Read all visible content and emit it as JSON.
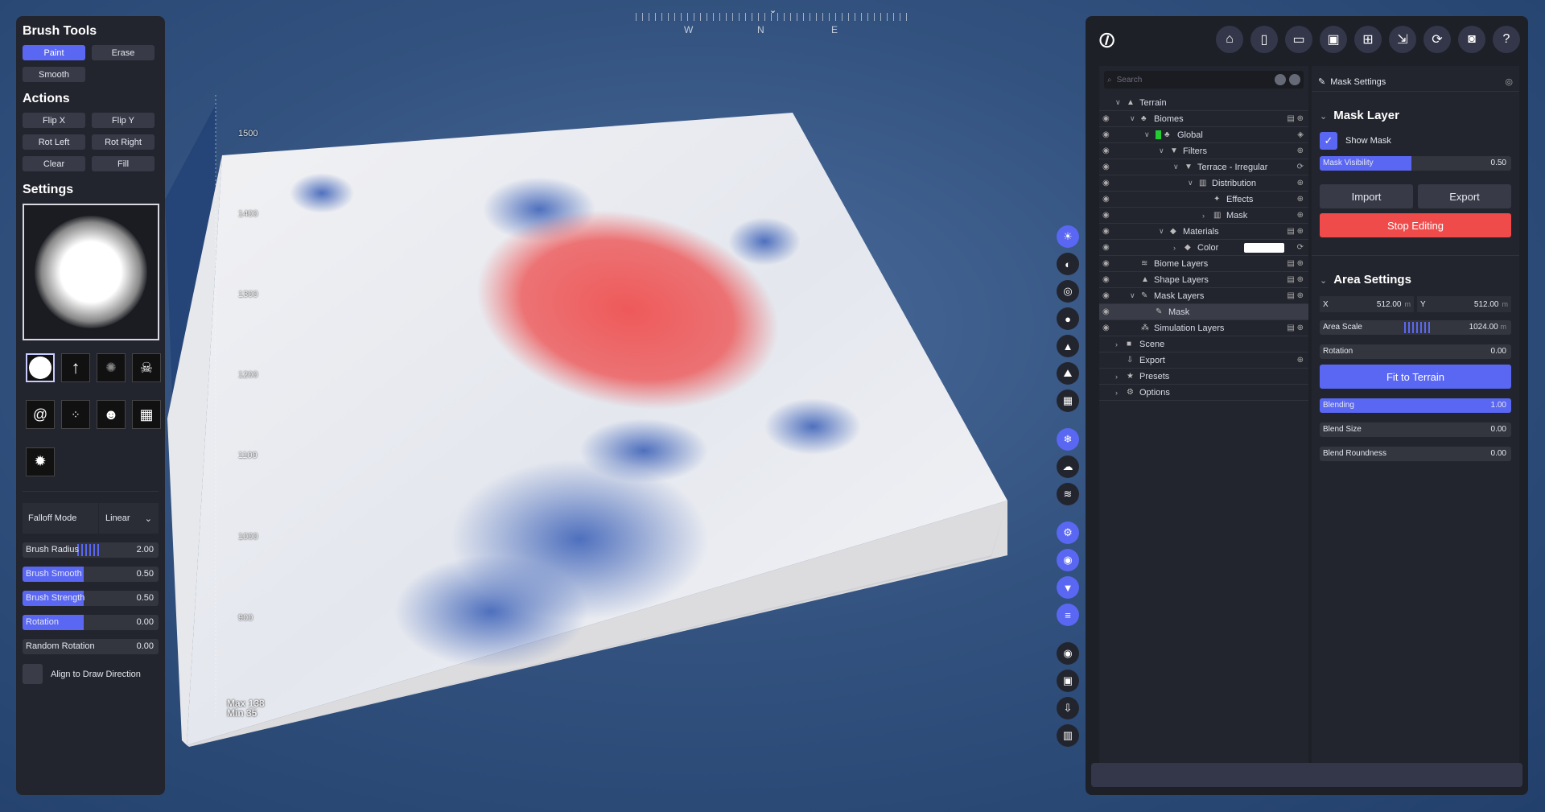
{
  "compass": {
    "labels": [
      "W",
      "N",
      "E"
    ]
  },
  "scale_labels": [
    "1500",
    "1400",
    "1300",
    "1200",
    "1100",
    "1000",
    "900"
  ],
  "stats": {
    "max": "Max 138",
    "min": "Min 35"
  },
  "brush_tools": {
    "title": "Brush Tools",
    "buttons": [
      "Paint",
      "Erase",
      "Smooth"
    ],
    "active": "Paint"
  },
  "actions": {
    "title": "Actions",
    "buttons": [
      "Flip X",
      "Flip Y",
      "Rot Left",
      "Rot Right",
      "Clear",
      "Fill"
    ]
  },
  "settings": {
    "title": "Settings",
    "brush_icons": [
      "circle-brush-icon",
      "arrow-brush-icon",
      "scatter-brush-icon",
      "skull-crossbones-brush-icon",
      "spiral-brush-icon",
      "dots-brush-icon",
      "skull-brush-icon",
      "checker-brush-icon",
      "splat-brush-icon"
    ],
    "falloff_label": "Falloff Mode",
    "falloff_value": "Linear",
    "sliders": [
      {
        "label": "Brush Radius",
        "value": "2.00",
        "fill": 0
      },
      {
        "label": "Brush Smooth",
        "value": "0.50",
        "fill": 0.45
      },
      {
        "label": "Brush Strength",
        "value": "0.50",
        "fill": 0.45
      },
      {
        "label": "Rotation",
        "value": "0.00",
        "fill": 0.45
      },
      {
        "label": "Random Rotation",
        "value": "0.00",
        "fill": 0
      }
    ],
    "align_label": "Align to Draw Direction"
  },
  "toolbar_icons": [
    "sun-icon",
    "globe-icon",
    "target-icon",
    "water-drop-icon",
    "mountain-icon",
    "person-landscape-icon",
    "grid-icon",
    "snowflake-icon",
    "cloud-icon",
    "waves-icon",
    "settings-icon",
    "eye-icon",
    "filter-icon",
    "layers-icon",
    "disc-icon",
    "image-icon",
    "download-icon",
    "chart-icon"
  ],
  "top_icons": [
    "home-icon",
    "new-file-icon",
    "open-folder-icon",
    "save-icon",
    "save-as-icon",
    "export-icon",
    "refresh-icon",
    "camera-icon",
    "help-icon"
  ],
  "search": {
    "placeholder": "Search"
  },
  "tree": [
    {
      "label": "Terrain",
      "depth": 0,
      "eye": false,
      "chev": "v",
      "icon": "▲",
      "action": ""
    },
    {
      "label": "Biomes",
      "depth": 1,
      "eye": true,
      "chev": "v",
      "icon": "♣",
      "action": "▤ ⊕"
    },
    {
      "label": "Global",
      "depth": 2,
      "eye": true,
      "chev": "v",
      "icon": "♣",
      "action": "◈",
      "swatch": "#22cc33"
    },
    {
      "label": "Filters",
      "depth": 3,
      "eye": true,
      "chev": "v",
      "icon": "▼",
      "action": "⊕"
    },
    {
      "label": "Terrace - Irregular",
      "depth": 4,
      "eye": true,
      "chev": "v",
      "icon": "▼",
      "action": "⟳"
    },
    {
      "label": "Distribution",
      "depth": 5,
      "eye": true,
      "chev": "v",
      "icon": "▥",
      "action": "⊕"
    },
    {
      "label": "Effects",
      "depth": 6,
      "eye": true,
      "chev": "",
      "icon": "✦",
      "action": "⊕"
    },
    {
      "label": "Mask",
      "depth": 6,
      "eye": true,
      "chev": ">",
      "icon": "▥",
      "action": "⊕"
    },
    {
      "label": "Materials",
      "depth": 3,
      "eye": true,
      "chev": "v",
      "icon": "◆",
      "action": "▤ ⊕"
    },
    {
      "label": "Color",
      "depth": 4,
      "eye": true,
      "chev": ">",
      "icon": "◆",
      "action": "⟳",
      "colorbar": true
    },
    {
      "label": "Biome Layers",
      "depth": 1,
      "eye": true,
      "chev": "",
      "icon": "≋",
      "action": "▤ ⊕"
    },
    {
      "label": "Shape Layers",
      "depth": 1,
      "eye": true,
      "chev": "",
      "icon": "▲",
      "action": "▤ ⊕"
    },
    {
      "label": "Mask Layers",
      "depth": 1,
      "eye": true,
      "chev": "v",
      "icon": "✎",
      "action": "▤ ⊕"
    },
    {
      "label": "Mask",
      "depth": 2,
      "eye": true,
      "chev": "",
      "icon": "✎",
      "action": "",
      "selected": true
    },
    {
      "label": "Simulation Layers",
      "depth": 1,
      "eye": true,
      "chev": "",
      "icon": "⁂",
      "action": "▤ ⊕"
    },
    {
      "label": "Scene",
      "depth": 0,
      "eye": false,
      "chev": ">",
      "icon": "■",
      "action": ""
    },
    {
      "label": "Export",
      "depth": 0,
      "eye": false,
      "chev": "",
      "icon": "⇩",
      "action": "⊕"
    },
    {
      "label": "Presets",
      "depth": 0,
      "eye": false,
      "chev": ">",
      "icon": "★",
      "action": ""
    },
    {
      "label": "Options",
      "depth": 0,
      "eye": false,
      "chev": ">",
      "icon": "⚙",
      "action": ""
    }
  ],
  "props": {
    "header": "Mask Settings",
    "mask_layer": {
      "title": "Mask Layer",
      "show_mask": "Show Mask",
      "mask_visibility": {
        "label": "Mask Visibility",
        "value": "0.50",
        "fill": 0.48
      },
      "import": "Import",
      "export": "Export",
      "stop": "Stop Editing"
    },
    "area": {
      "title": "Area Settings",
      "x_label": "X",
      "x_value": "512.00",
      "y_label": "Y",
      "y_value": "512.00",
      "unit": "m",
      "scale": {
        "label": "Area Scale",
        "value": "1024.00",
        "unit": "m"
      },
      "rotation": {
        "label": "Rotation",
        "value": "0.00",
        "fill": 0
      },
      "fit": "Fit to Terrain",
      "blending": {
        "label": "Blending",
        "value": "1.00",
        "fill": 1
      },
      "blend_size": {
        "label": "Blend Size",
        "value": "0.00",
        "fill": 0
      },
      "blend_roundness": {
        "label": "Blend Roundness",
        "value": "0.00",
        "fill": 0
      }
    }
  }
}
